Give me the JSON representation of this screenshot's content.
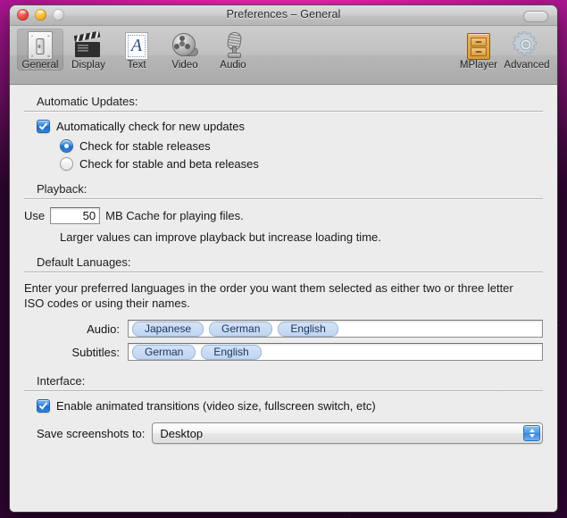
{
  "window": {
    "title": "Preferences – General",
    "controls": {
      "close": "close-button",
      "minimize": "minimize-button",
      "zoom": "zoom-button"
    }
  },
  "toolbar": {
    "left_items": [
      {
        "label": "General",
        "icon": "light-switch-icon",
        "selected": true
      },
      {
        "label": "Display",
        "icon": "clapperboard-icon",
        "selected": false
      },
      {
        "label": "Text",
        "icon": "text-a-icon",
        "selected": false
      },
      {
        "label": "Video",
        "icon": "film-reel-icon",
        "selected": false
      },
      {
        "label": "Audio",
        "icon": "microphone-icon",
        "selected": false
      }
    ],
    "right_items": [
      {
        "label": "MPlayer",
        "icon": "drawer-cabinet-icon",
        "selected": false
      },
      {
        "label": "Advanced",
        "icon": "gear-icon",
        "selected": false
      }
    ]
  },
  "sections": {
    "updates": {
      "heading": "Automatic Updates:",
      "checkbox_label": "Automatically check for new updates",
      "checkbox_checked": true,
      "radios": [
        {
          "label": "Check for stable releases",
          "selected": true
        },
        {
          "label": "Check for stable and beta releases",
          "selected": false
        }
      ]
    },
    "playback": {
      "heading": "Playback:",
      "prefix": "Use",
      "cache_value": "50",
      "suffix": "MB Cache for playing files.",
      "hint": "Larger values can improve playback but increase loading time."
    },
    "languages": {
      "heading": "Default Lanuages:",
      "description": "Enter your preferred languages in the order you want them selected as either two or three letter ISO codes or using their names.",
      "audio_label": "Audio:",
      "audio_tokens": [
        "Japanese",
        "German",
        "English"
      ],
      "subtitles_label": "Subtitles:",
      "subtitles_tokens": [
        "German",
        "English"
      ]
    },
    "interface": {
      "heading": "Interface:",
      "checkbox_label": "Enable animated transitions (video size, fullscreen switch, etc)",
      "checkbox_checked": true,
      "save_label": "Save screenshots to:",
      "save_value": "Desktop"
    }
  },
  "colors": {
    "accent_blue": "#2f7fd8",
    "window_bg": "#ececec",
    "titlebar": "#c6c6c6",
    "token_bg": "#c8daf2",
    "wallpaper_pink": "#e81fb0"
  }
}
